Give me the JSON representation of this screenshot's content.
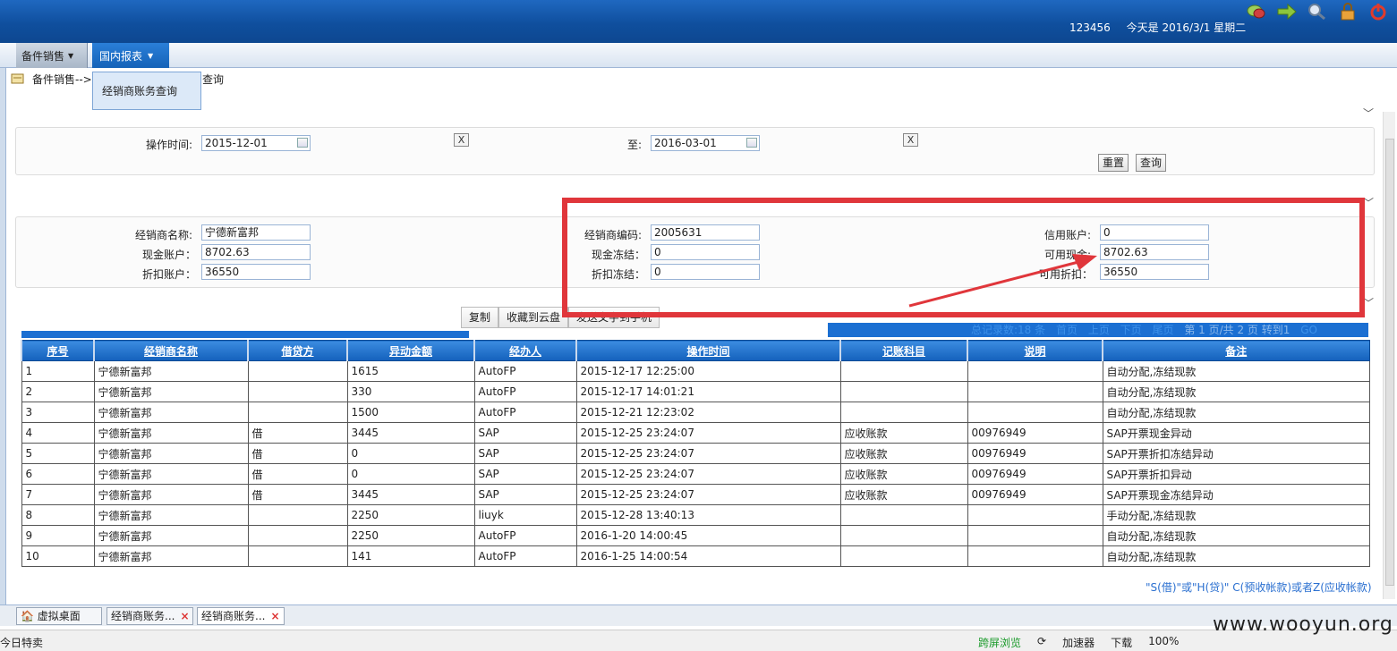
{
  "header": {
    "user_id": "123456",
    "date_text": "今天是 2016/3/1 星期二"
  },
  "menu": {
    "item1": "备件销售",
    "item2": "国内报表",
    "dropdown_item": "经销商账务查询"
  },
  "breadcrumb": {
    "head": "备件销售-->",
    "tail": "查询"
  },
  "query": {
    "op_time_label": "操作时间:",
    "from_value": "2015-12-01",
    "to_label": "至:",
    "to_value": "2016-03-01",
    "x_label": "X",
    "reset_label": "重置",
    "search_label": "查询"
  },
  "info": {
    "dealer_name_label": "经销商名称:",
    "dealer_name_value": "宁德新富邦",
    "cash_account_label": "现金账户：",
    "cash_account_value": "8702.63",
    "discount_account_label": "折扣账户：",
    "discount_account_value": "36550",
    "dealer_code_label": "经销商编码:",
    "dealer_code_value": "2005631",
    "cash_frozen_label": "现金冻结：",
    "cash_frozen_value": "0",
    "discount_frozen_label": "折扣冻结：",
    "discount_frozen_value": "0",
    "credit_account_label": "信用账户:",
    "credit_account_value": "0",
    "available_cash_label": "可用现金:",
    "available_cash_value": "8702.63",
    "available_discount_label": "可用折扣：",
    "available_discount_value": "36550"
  },
  "grid_tools": {
    "copy": "复制",
    "save_cloud": "收藏到云盘",
    "send_phone": "发送文字到手机"
  },
  "pager": {
    "total": "总记录数:18 条",
    "first": "首页",
    "prev": "上页",
    "next": "下页",
    "last": "尾页",
    "page_info": "第 1 页/共 2 页 转到1",
    "go": "GO"
  },
  "table": {
    "headers": [
      "序号",
      "经销商名称",
      "借贷方",
      "异动金额",
      "经办人",
      "操作时间",
      "记账科目",
      "说明",
      "备注"
    ],
    "rows": [
      [
        "1",
        "宁德新富邦",
        "",
        "1615",
        "AutoFP",
        "2015-12-17 12:25:00",
        "",
        "",
        "自动分配,冻结现款"
      ],
      [
        "2",
        "宁德新富邦",
        "",
        "330",
        "AutoFP",
        "2015-12-17 14:01:21",
        "",
        "",
        "自动分配,冻结现款"
      ],
      [
        "3",
        "宁德新富邦",
        "",
        "1500",
        "AutoFP",
        "2015-12-21 12:23:02",
        "",
        "",
        "自动分配,冻结现款"
      ],
      [
        "4",
        "宁德新富邦",
        "借",
        "3445",
        "SAP",
        "2015-12-25 23:24:07",
        "应收账款",
        "00976949",
        "SAP开票现金异动"
      ],
      [
        "5",
        "宁德新富邦",
        "借",
        "0",
        "SAP",
        "2015-12-25 23:24:07",
        "应收账款",
        "00976949",
        "SAP开票折扣冻结异动"
      ],
      [
        "6",
        "宁德新富邦",
        "借",
        "0",
        "SAP",
        "2015-12-25 23:24:07",
        "应收账款",
        "00976949",
        "SAP开票折扣异动"
      ],
      [
        "7",
        "宁德新富邦",
        "借",
        "3445",
        "SAP",
        "2015-12-25 23:24:07",
        "应收账款",
        "00976949",
        "SAP开票现金冻结异动"
      ],
      [
        "8",
        "宁德新富邦",
        "",
        "2250",
        "liuyk",
        "2015-12-28 13:40:13",
        "",
        "",
        "手动分配,冻结现款"
      ],
      [
        "9",
        "宁德新富邦",
        "",
        "2250",
        "AutoFP",
        "2016-1-20 14:00:45",
        "",
        "",
        "自动分配,冻结现款"
      ],
      [
        "10",
        "宁德新富邦",
        "",
        "141",
        "AutoFP",
        "2016-1-25 14:00:54",
        "",
        "",
        "自动分配,冻结现款"
      ]
    ]
  },
  "footnote": "\"S(借)\"或\"H(贷)\" C(预收帐款)或者Z(应收帐款)",
  "tabs": {
    "desktop": "虚拟桌面",
    "tab1": "经销商账务...",
    "tab2": "经销商账务...",
    "close": "×"
  },
  "status": {
    "left": "今日特卖",
    "cross_screen": "跨屏浏览",
    "accelerator": "加速器",
    "download": "下载",
    "zoom": "100%"
  },
  "watermark": "www.wooyun.org",
  "colors": {
    "header_blue": "#0f4f9e",
    "highlight_red": "#e0363b",
    "grid_header": "#1461bc"
  }
}
